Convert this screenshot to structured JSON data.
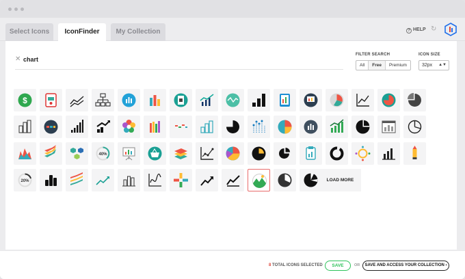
{
  "window": {
    "controls": [
      "close",
      "minimize",
      "maximize"
    ]
  },
  "tabs": [
    {
      "label": "Select Icons",
      "active": false
    },
    {
      "label": "IconFinder",
      "active": true
    },
    {
      "label": "My Collection",
      "active": false
    }
  ],
  "header": {
    "help_label": "HELP",
    "refresh_icon": "refresh-icon",
    "logo_icon": "iconfinder-logo"
  },
  "search": {
    "value": "chart",
    "clear_icon": "close-icon"
  },
  "filter": {
    "label": "FILTER SEARCH",
    "options": [
      "All",
      "Free",
      "Premium"
    ],
    "selected": "Free"
  },
  "icon_size": {
    "label": "ICON SIZE",
    "value": "32px"
  },
  "results": {
    "icons": [
      "dollar-coin-icon",
      "clipboard-chart-icon",
      "line-chart-icon",
      "org-chart-icon",
      "bar-chart-circle-icon",
      "colored-bars-icon",
      "document-chart-circle-icon",
      "line-bar-chart-icon",
      "line-circle-icon",
      "bar-chart-solid-icon",
      "tablet-chart-icon",
      "presentation-circle-icon",
      "pie-circle-icon",
      "line-axes-icon",
      "pie-circle-red-icon",
      "pie-chart-icon",
      "bar-outline-icon",
      "bar-circle-dark-icon",
      "ascending-bars-icon",
      "growth-arrow-icon",
      "flower-chart-icon",
      "colored-bars-2-icon",
      "waterfall-chart-icon",
      "blue-bars-icon",
      "pie-quarter-icon",
      "dotted-bars-icon",
      "pie-multicolor-icon",
      "bar-circle-gray-icon",
      "green-bars-arrow-icon",
      "pie-solid-icon",
      "browser-chart-icon",
      "pie-outline-icon",
      "area-chart-icon",
      "layers-arrow-icon",
      "hexagon-network-icon",
      "progress-40-icon",
      "presentation-board-icon",
      "basket-circle-icon",
      "stacked-layers-icon",
      "scatter-line-icon",
      "donut-multicolor-icon",
      "pie-circle-dark-icon",
      "pie-slices-icon",
      "clipboard-blue-icon",
      "donut-outline-icon",
      "sun-donut-icon",
      "bar-axes-icon",
      "pencil-bar-icon",
      "progress-20-icon",
      "bar-solid-black-icon",
      "layers-steps-icon",
      "trend-arrow-icon",
      "bar-outline-2-icon",
      "wave-chart-icon",
      "cross-plus-icon",
      "trend-up-box-icon",
      "trend-line-icon",
      "landscape-circle-icon",
      "pie-dark-circle-icon",
      "pie-black-icon"
    ],
    "selected_index": 57,
    "load_more_label": "LOAD MORE"
  },
  "footer": {
    "count": "8",
    "count_label": "TOTAL ICONS SELECTED",
    "save_label": "SAVE",
    "or_label": "OR",
    "save_collection_label": "SAVE AND ACCESS YOUR COLLECTION",
    "save_collection_icon": "chevron-right-icon"
  },
  "colors": {
    "accent_green": "#2ec25a",
    "count_red": "#e0463b",
    "highlight": "#e86b6b",
    "brand_blue": "#1f6feb"
  }
}
